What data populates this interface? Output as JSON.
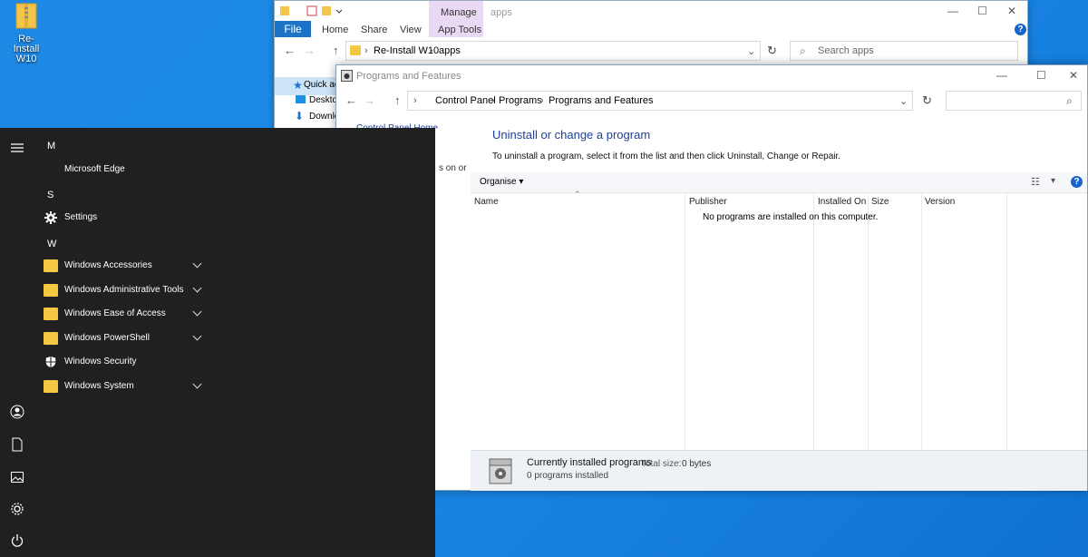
{
  "desktop": {
    "icon_label": "Re-Install W10"
  },
  "explorer": {
    "context_tab": "Manage",
    "window_title": "apps",
    "tabs": [
      "File",
      "Home",
      "Share",
      "View",
      "App Tools"
    ],
    "breadcrumb": [
      "Re-Install W10",
      "apps"
    ],
    "search_placeholder": "Search apps",
    "nav_items": [
      "Quick ac",
      "Desktop",
      "Downlo"
    ]
  },
  "programs": {
    "window_title": "Programs and Features",
    "breadcrumb": [
      "Control Panel",
      "Programs",
      "Programs and Features"
    ],
    "sidebar_partial": "Control Panel Home",
    "sidebar_partial2": "s on or",
    "heading": "Uninstall or change a program",
    "description": "To uninstall a program, select it from the list and then click Uninstall, Change or Repair.",
    "organise_label": "Organise",
    "columns": [
      "Name",
      "Publisher",
      "Installed On",
      "Size",
      "Version"
    ],
    "empty_message": "No programs are installed on this computer.",
    "footer": {
      "title": "Currently installed programs",
      "total_label": "Total size:",
      "total_value": "0 bytes",
      "count": "0 programs installed"
    }
  },
  "start_menu": {
    "groups": [
      {
        "letter": "M",
        "apps": [
          {
            "label": "Microsoft Edge",
            "icon": "edge-icon",
            "expandable": false
          }
        ]
      },
      {
        "letter": "S",
        "apps": [
          {
            "label": "Settings",
            "icon": "gear-icon",
            "expandable": false
          }
        ]
      },
      {
        "letter": "W",
        "apps": [
          {
            "label": "Windows Accessories",
            "icon": "folder-icon",
            "expandable": true
          },
          {
            "label": "Windows Administrative Tools",
            "icon": "folder-icon",
            "expandable": true
          },
          {
            "label": "Windows Ease of Access",
            "icon": "folder-icon",
            "expandable": true
          },
          {
            "label": "Windows PowerShell",
            "icon": "folder-icon",
            "expandable": true
          },
          {
            "label": "Windows Security",
            "icon": "shield-icon",
            "expandable": false
          },
          {
            "label": "Windows System",
            "icon": "folder-icon",
            "expandable": true
          }
        ]
      }
    ]
  }
}
